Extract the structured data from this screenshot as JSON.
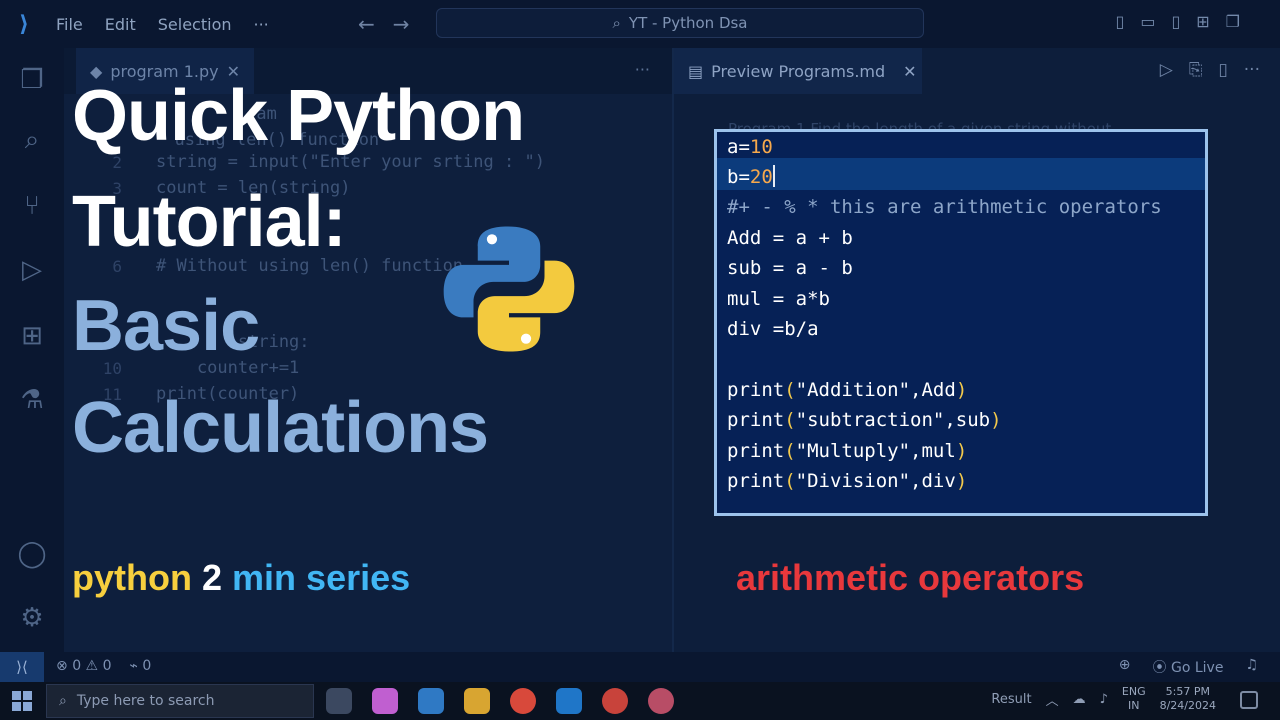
{
  "window": {
    "menu": [
      "File",
      "Edit",
      "Selection",
      "···"
    ],
    "search_text": "YT - Python Dsa"
  },
  "editor": {
    "tab_label": "program 1.py",
    "lines": [
      {
        "no": "",
        "text": "         ram"
      },
      {
        "no": "",
        "text": "  using len() function"
      },
      {
        "no": "2",
        "text": "string = input(\"Enter your srting : \")"
      },
      {
        "no": "3",
        "text": "count = len(string)"
      },
      {
        "no": "6",
        "text": "# Without using len() function"
      },
      {
        "no": "",
        "text": "        string:"
      },
      {
        "no": "10",
        "text": "    counter+=1"
      },
      {
        "no": "11",
        "text": "print(counter)"
      },
      {
        "no": "12",
        "text": ""
      }
    ]
  },
  "preview": {
    "tab_label": "Preview Programs.md",
    "faint_text": "Program 1 Find the length of a given string without"
  },
  "statusbar": {
    "errors": "0",
    "warnings": "0",
    "ports": "0",
    "go_live": "Go Live"
  },
  "taskbar": {
    "search_placeholder": "Type here to search",
    "tray_result": "Result",
    "lang_line1": "ENG",
    "lang_line2": "IN",
    "time": "5:57 PM",
    "date": "8/24/2024"
  },
  "thumbnail": {
    "title_line1": "Quick Python",
    "title_line2": "Tutorial:",
    "title_line3": "Basic",
    "title_line4": "Calculations",
    "series_python": "python",
    "series_number": "2",
    "series_rest": "min series",
    "topic": "arithmetic operators"
  },
  "code_box": {
    "lines": [
      "a=10",
      "b=20",
      "#+ - % * this are arithmetic operators",
      "Add = a + b",
      "sub = a - b",
      "mul = a*b",
      "div =b/a",
      "",
      "print(\"Addition\",Add)",
      "print(\"subtraction\",sub)",
      "print(\"Multuply\",mul)",
      "print(\"Division\",div)"
    ]
  },
  "colors": {
    "title_white": "#ffffff",
    "title_blue": "#8bb0dc",
    "series_python": "#f7cf3e",
    "series_min": "#41b6f4",
    "topic_red": "#e8383c",
    "code_box_bg": "#062156",
    "code_box_border": "#9cc3ec"
  },
  "icons": [
    "vscode-logo-icon",
    "explorer-icon",
    "search-icon",
    "source-control-icon",
    "run-debug-icon",
    "extensions-icon",
    "testing-icon",
    "account-icon",
    "settings-gear-icon",
    "python-logo-icon"
  ]
}
